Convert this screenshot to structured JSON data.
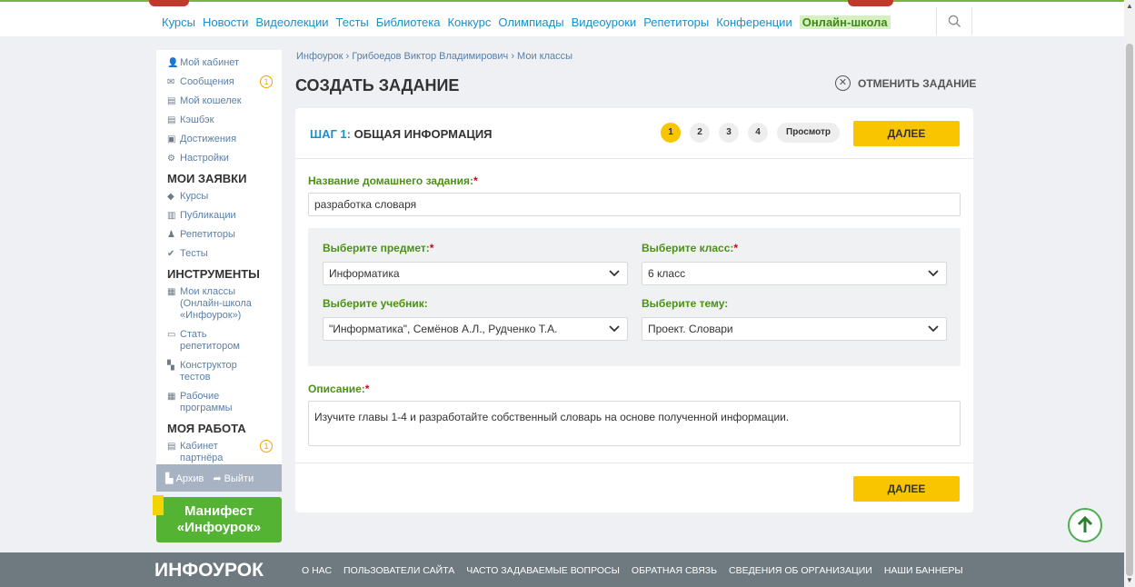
{
  "nav": {
    "items": [
      "Курсы",
      "Новости",
      "Видеолекции",
      "Тесты",
      "Библиотека",
      "Конкурс",
      "Олимпиады",
      "Видеоуроки",
      "Репетиторы",
      "Конференции"
    ],
    "online_school": "Онлайн-школа"
  },
  "sidebar": {
    "account": [
      {
        "icon": "user-icon",
        "label": "Мой кабинет"
      },
      {
        "icon": "mail-icon",
        "label": "Сообщения",
        "count": "1"
      },
      {
        "icon": "wallet-icon",
        "label": "Мой кошелек"
      },
      {
        "icon": "cashback-icon",
        "label": "Кэшбэк"
      },
      {
        "icon": "trophy-icon",
        "label": "Достижения"
      },
      {
        "icon": "gear-icon",
        "label": "Настройки"
      }
    ],
    "requests_heading": "МОИ ЗАЯВКИ",
    "requests": [
      {
        "icon": "graduation-icon",
        "label": "Курсы"
      },
      {
        "icon": "book-icon",
        "label": "Публикации"
      },
      {
        "icon": "tutor-icon",
        "label": "Репетиторы"
      },
      {
        "icon": "check-icon",
        "label": "Тесты"
      }
    ],
    "tools_heading": "ИНСТРУМЕНТЫ",
    "tools": [
      {
        "icon": "classes-icon",
        "label": "Мои классы (Онлайн-школа «Инфоурок»)"
      },
      {
        "icon": "board-icon",
        "label": "Стать репетитором"
      },
      {
        "icon": "grid-icon",
        "label": "Конструктор тестов"
      },
      {
        "icon": "calendar-icon",
        "label": "Рабочие программы"
      }
    ],
    "work_heading": "МОЯ РАБОТА",
    "work": [
      {
        "icon": "partner-icon",
        "label": "Кабинет партнёра",
        "count": "1"
      }
    ],
    "archive": "Архив",
    "logout": "Выйти"
  },
  "manifest": {
    "line1": "Манифест",
    "line2": "«Инфоурок»"
  },
  "breadcrumb": "Инфоурок › Грибоедов Виктор Владимирович › Мои классы",
  "title": "СОЗДАТЬ ЗАДАНИЕ",
  "cancel": "ОТМЕНИТЬ ЗАДАНИЕ",
  "step": {
    "prefix": "ШАГ 1:",
    "name": "ОБЩАЯ ИНФОРМАЦИЯ",
    "numbers": [
      "1",
      "2",
      "3",
      "4"
    ],
    "preview": "Просмотр",
    "next": "ДАЛЕЕ"
  },
  "form": {
    "hw_label": "Название домашнего задания:",
    "hw_value": "разработка словаря",
    "subject_label": "Выберите предмет:",
    "subject_value": "Информатика",
    "class_label": "Выберите класс:",
    "class_value": "6 класс",
    "textbook_label": "Выберите учебник:",
    "textbook_value": "\"Информатика\", Семёнов А.Л., Рудченко Т.А.",
    "topic_label": "Выберите тему:",
    "topic_value": "Проект. Словари",
    "desc_label": "Описание:",
    "desc_value": "Изучите главы 1-4 и разработайте собственный словарь на основе полученной информации.",
    "required_mark": "*"
  },
  "footer": {
    "logo": "ИНФОУРОК",
    "links": [
      "О НАС",
      "ПОЛЬЗОВАТЕЛИ САЙТА",
      "ЧАСТО ЗАДАВАЕМЫЕ ВОПРОСЫ",
      "ОБРАТНАЯ СВЯЗЬ",
      "СВЕДЕНИЯ ОБ ОРГАНИЗАЦИИ",
      "НАШИ БАННЕРЫ"
    ]
  },
  "colors": {
    "accent": "#f8c500",
    "link": "#1a8fc9",
    "green": "#54b333",
    "required": "#d0021b"
  }
}
